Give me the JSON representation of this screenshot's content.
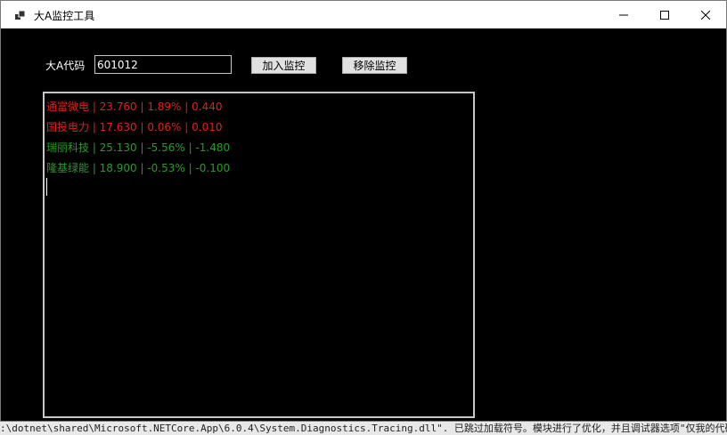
{
  "window": {
    "title": "大A监控工具",
    "minimize_glyph": "—",
    "maximize_glyph": "☐",
    "close_glyph": "✕",
    "icon": "app-icon"
  },
  "form": {
    "code_label": "大A代码",
    "code_value": "601012",
    "add_button": "加入监控",
    "remove_button": "移除监控"
  },
  "stocks": [
    {
      "text": "通富微电 | 23.760 | 1.89%  | 0.440",
      "trend": "up"
    },
    {
      "text": "国投电力 | 17.630 | 0.06%  | 0.010",
      "trend": "up"
    },
    {
      "text": "瑞丽科技 | 25.130 | -5.56%  | -1.480",
      "trend": "down"
    },
    {
      "text": "隆基绿能 | 18.900 | -0.53%  | -0.100",
      "trend": "down"
    }
  ],
  "colors": {
    "up": "#e0201a",
    "down": "#2a9a2a",
    "background": "#000000"
  },
  "background_status": ":\\dotnet\\shared\\Microsoft.NETCore.App\\6.0.4\\System.Diagnostics.Tracing.dll\". 已跳过加载符号。模块进行了优化，并且调试器选项\"仅我的代码\""
}
